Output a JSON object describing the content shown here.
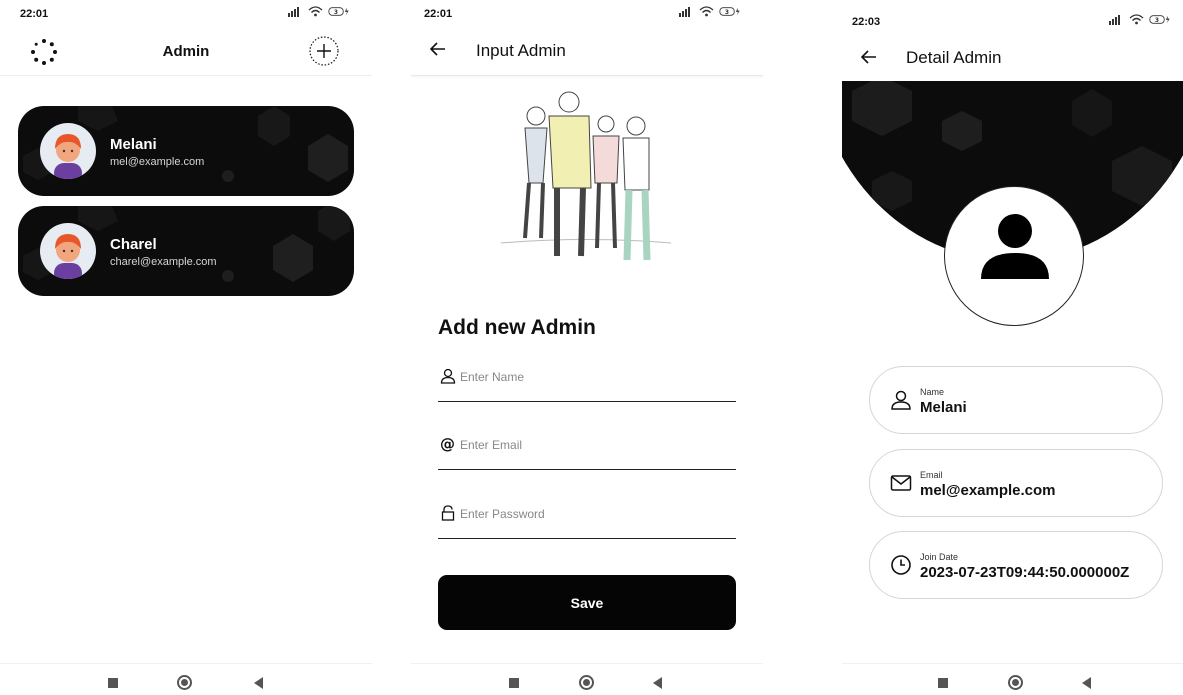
{
  "screen_list": {
    "status_time": "22:01",
    "title": "Admin",
    "admins": [
      {
        "name": "Melani",
        "email": "mel@example.com"
      },
      {
        "name": "Charel",
        "email": "charel@example.com"
      }
    ]
  },
  "screen_input": {
    "status_time": "22:01",
    "title": "Input Admin",
    "form_title": "Add new Admin",
    "fields": {
      "name_placeholder": "Enter Name",
      "email_placeholder": "Enter Email",
      "password_placeholder": "Enter Password"
    },
    "save_label": "Save"
  },
  "screen_detail": {
    "status_time": "22:03",
    "title": "Detail Admin",
    "name_label": "Name",
    "name_value": "Melani",
    "email_label": "Email",
    "email_value": "mel@example.com",
    "join_label": "Join Date",
    "join_value": "2023-07-23T09:44:50.000000Z"
  },
  "colors": {
    "card_bg": "#0c0c0c",
    "button_bg": "#050505",
    "accent_text": "#ffffff",
    "avatar_hair": "#e8572b",
    "avatar_shirt": "#6b3fa0"
  },
  "status_icons": [
    "signal-icon",
    "wifi-icon",
    "battery-charging-icon"
  ]
}
